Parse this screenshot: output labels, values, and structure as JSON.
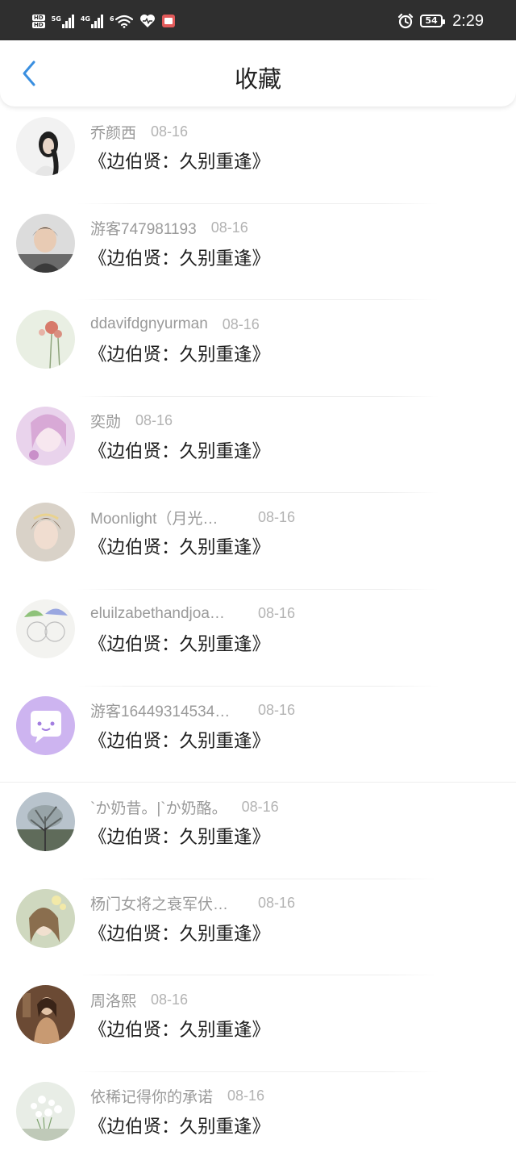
{
  "status_bar": {
    "badges": [
      "HD",
      "HD"
    ],
    "network_1": "5G",
    "network_2": "4G",
    "wifi_label": "6",
    "battery": "54",
    "time": "2:29",
    "icons": [
      "signal-icon",
      "wifi-icon",
      "heart-icon",
      "book-app-icon",
      "alarm-icon",
      "battery-icon"
    ]
  },
  "nav": {
    "back_icon": "chevron-left-icon",
    "title": "收藏",
    "accent": "#3a8fe0"
  },
  "items": [
    {
      "user": "乔颜西",
      "date": "08-16",
      "book": "《边伯贤：久别重逢》",
      "truncated": false
    },
    {
      "user": "游客747981193",
      "date": "08-16",
      "book": "《边伯贤：久别重逢》",
      "truncated": false
    },
    {
      "user": "ddavifdgnyurman",
      "date": "08-16",
      "book": "《边伯贤：久别重逢》",
      "truncated": false
    },
    {
      "user": "奕勋",
      "date": "08-16",
      "book": "《边伯贤：久别重逢》",
      "truncated": false
    },
    {
      "user": "Moonlight（月光…",
      "date": "08-16",
      "book": "《边伯贤：久别重逢》",
      "truncated": true
    },
    {
      "user": "eluilzabethandjoa…",
      "date": "08-16",
      "book": "《边伯贤：久别重逢》",
      "truncated": true
    },
    {
      "user": "游客16449314534…",
      "date": "08-16",
      "book": "《边伯贤：久别重逢》",
      "truncated": true
    },
    {
      "user": "`か奶昔。|`か奶酪。",
      "date": "08-16",
      "book": "《边伯贤：久别重逢》",
      "truncated": false
    },
    {
      "user": "杨门女将之衰军伏…",
      "date": "08-16",
      "book": "《边伯贤：久别重逢》",
      "truncated": true
    },
    {
      "user": "周洛熙",
      "date": "08-16",
      "book": "《边伯贤：久别重逢》",
      "truncated": false
    },
    {
      "user": "依稀记得你的承诺",
      "date": "08-16",
      "book": "《边伯贤：久别重逢》",
      "truncated": false
    }
  ]
}
